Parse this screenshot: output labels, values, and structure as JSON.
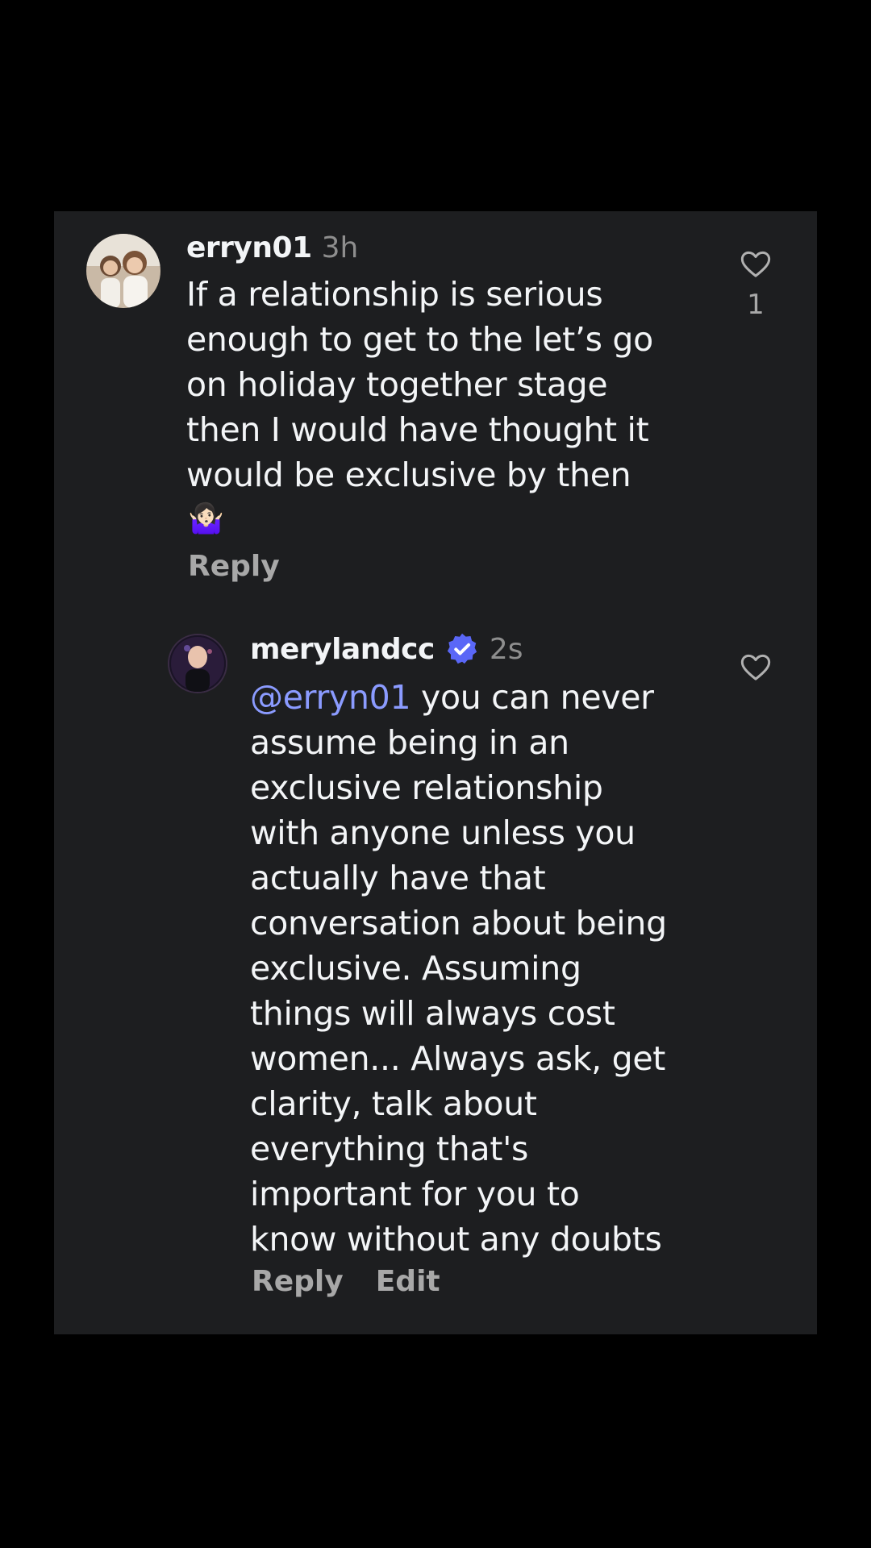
{
  "comment": {
    "username": "erryn01",
    "time": "3h",
    "text": "If a relationship is serious\nenough to get to the let’s go\non holiday together stage\nthen I would have thought it\nwould be exclusive by then",
    "emoji": "🤷🏻‍♀️",
    "reply_label": "Reply",
    "like_count": "1",
    "icons": {
      "like": "heart-icon",
      "avatar": "avatar-photo"
    }
  },
  "reply": {
    "username": "merylandcc",
    "time": "2s",
    "verified": true,
    "mention": "@erryn01",
    "text": " you can never\nassume being in an\nexclusive relationship\nwith anyone unless you\nactually have that\nconversation about being\nexclusive.  Assuming\nthings will always cost\nwomen... Always ask, get\nclarity, talk about\neverything that's\nimportant for you to\nknow without any doubts",
    "reply_label": "Reply",
    "edit_label": "Edit",
    "icons": {
      "like": "heart-icon",
      "verified": "verified-badge-icon",
      "avatar": "avatar-photo"
    }
  },
  "colors": {
    "background": "#000000",
    "card": "#1d1e20",
    "text": "#f3f5f7",
    "muted": "#8e8e8e",
    "mention": "#8b9bff",
    "verified": "#5a67f7"
  }
}
